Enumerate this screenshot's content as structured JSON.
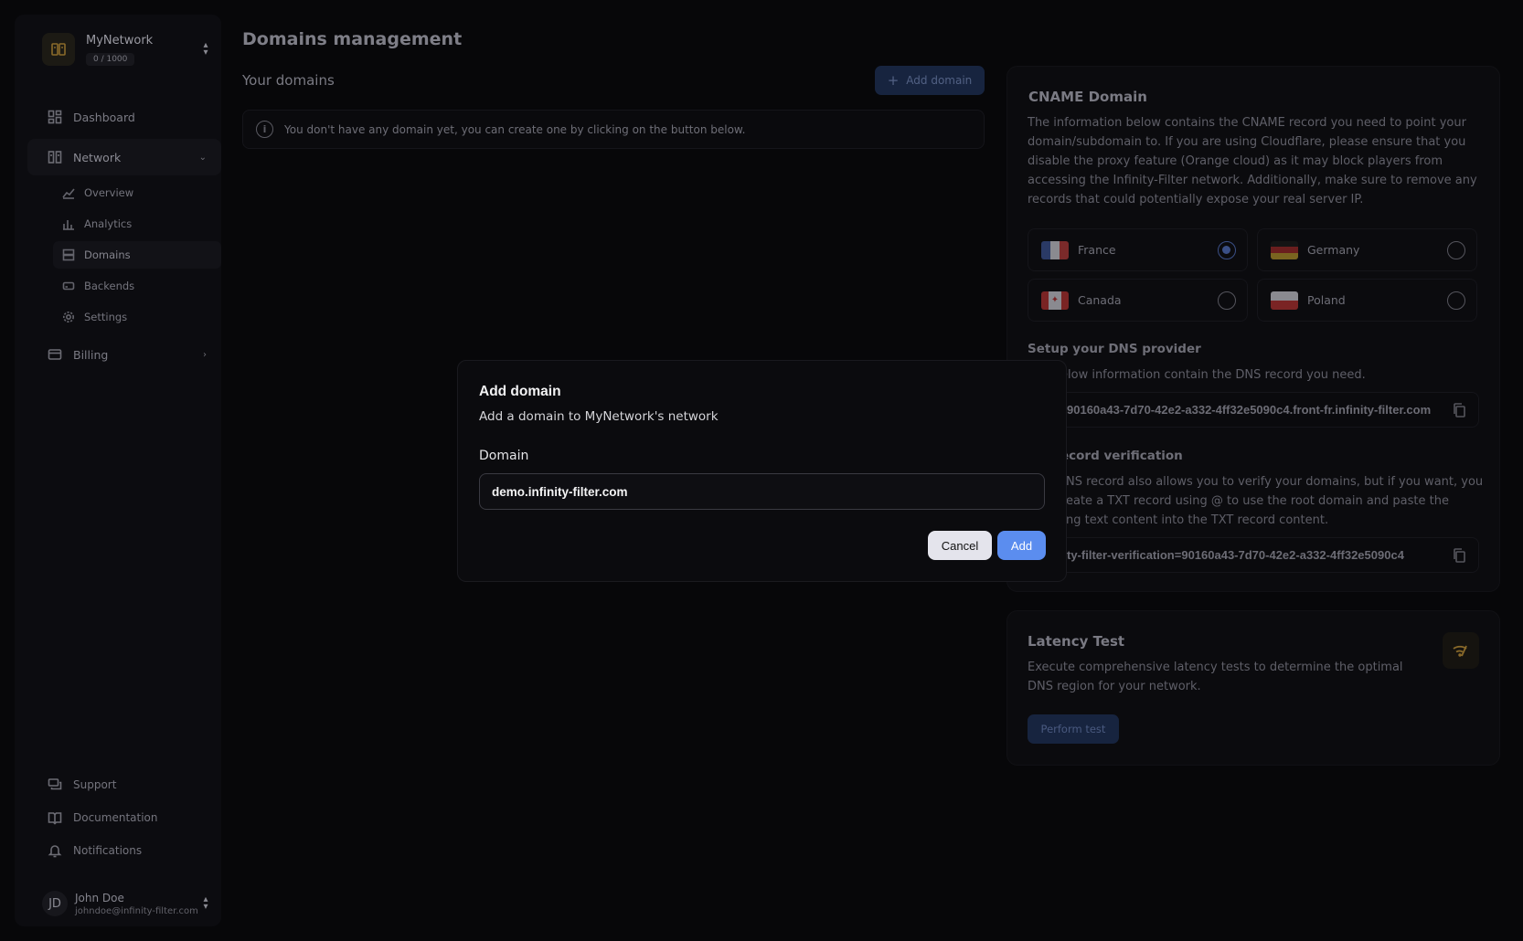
{
  "network": {
    "name": "MyNetwork",
    "count": "0 / 1000"
  },
  "sidebar": {
    "items": [
      {
        "label": "Dashboard"
      },
      {
        "label": "Network"
      },
      {
        "label": "Billing"
      }
    ],
    "network_sub": [
      {
        "label": "Overview"
      },
      {
        "label": "Analytics"
      },
      {
        "label": "Domains"
      },
      {
        "label": "Backends"
      },
      {
        "label": "Settings"
      }
    ],
    "bottom": [
      {
        "label": "Support"
      },
      {
        "label": "Documentation"
      },
      {
        "label": "Notifications"
      }
    ]
  },
  "user": {
    "initials": "JD",
    "name": "John Doe",
    "email": "johndoe@infinity-filter.com"
  },
  "main": {
    "title": "Domains management",
    "domains_header": "Your domains",
    "add_domain_label": "Add domain",
    "empty_alert": "You don't have any domain yet, you can create one by clicking on the button below."
  },
  "cname": {
    "title": "CNAME Domain",
    "description": "The information below contains the CNAME record you need to point your domain/subdomain to. If you are using Cloudflare, please ensure that you disable the proxy feature (Orange cloud) as it may block players from accessing the Infinity-Filter network. Additionally, make sure to remove any records that could potentially expose your real server IP.",
    "regions": [
      {
        "label": "France",
        "selected": true
      },
      {
        "label": "Germany",
        "selected": false
      },
      {
        "label": "Canada",
        "selected": false
      },
      {
        "label": "Poland",
        "selected": false
      }
    ],
    "dns_title": "Setup your DNS provider",
    "dns_desc": "elow information contain the DNS record you need.",
    "dns_record": "90160a43-7d70-42e2-a332-4ff32e5090c4.front-fr.infinity-filter.com",
    "verify_title": "ecord verification",
    "verify_desc_1": "NS record also allows you to verify your domains, but if you want, you",
    "verify_desc_2": "eate a TXT record using @ to use the root domain and paste the",
    "verify_desc_3": "ng text content into the TXT record content.",
    "verify_record": "ty-filter-verification=90160a43-7d70-42e2-a332-4ff32e5090c4"
  },
  "latency": {
    "title": "Latency Test",
    "description": "Execute comprehensive latency tests to determine the optimal DNS region for your network.",
    "button": "Perform test"
  },
  "dialog": {
    "title": "Add domain",
    "subtitle": "Add a domain to MyNetwork's network",
    "field_label": "Domain",
    "field_value": "demo.infinity-filter.com",
    "cancel_label": "Cancel",
    "add_label": "Add"
  },
  "colors": {
    "accent": "#5b8def",
    "background": "#070709",
    "logo": "#8a6a2a"
  }
}
